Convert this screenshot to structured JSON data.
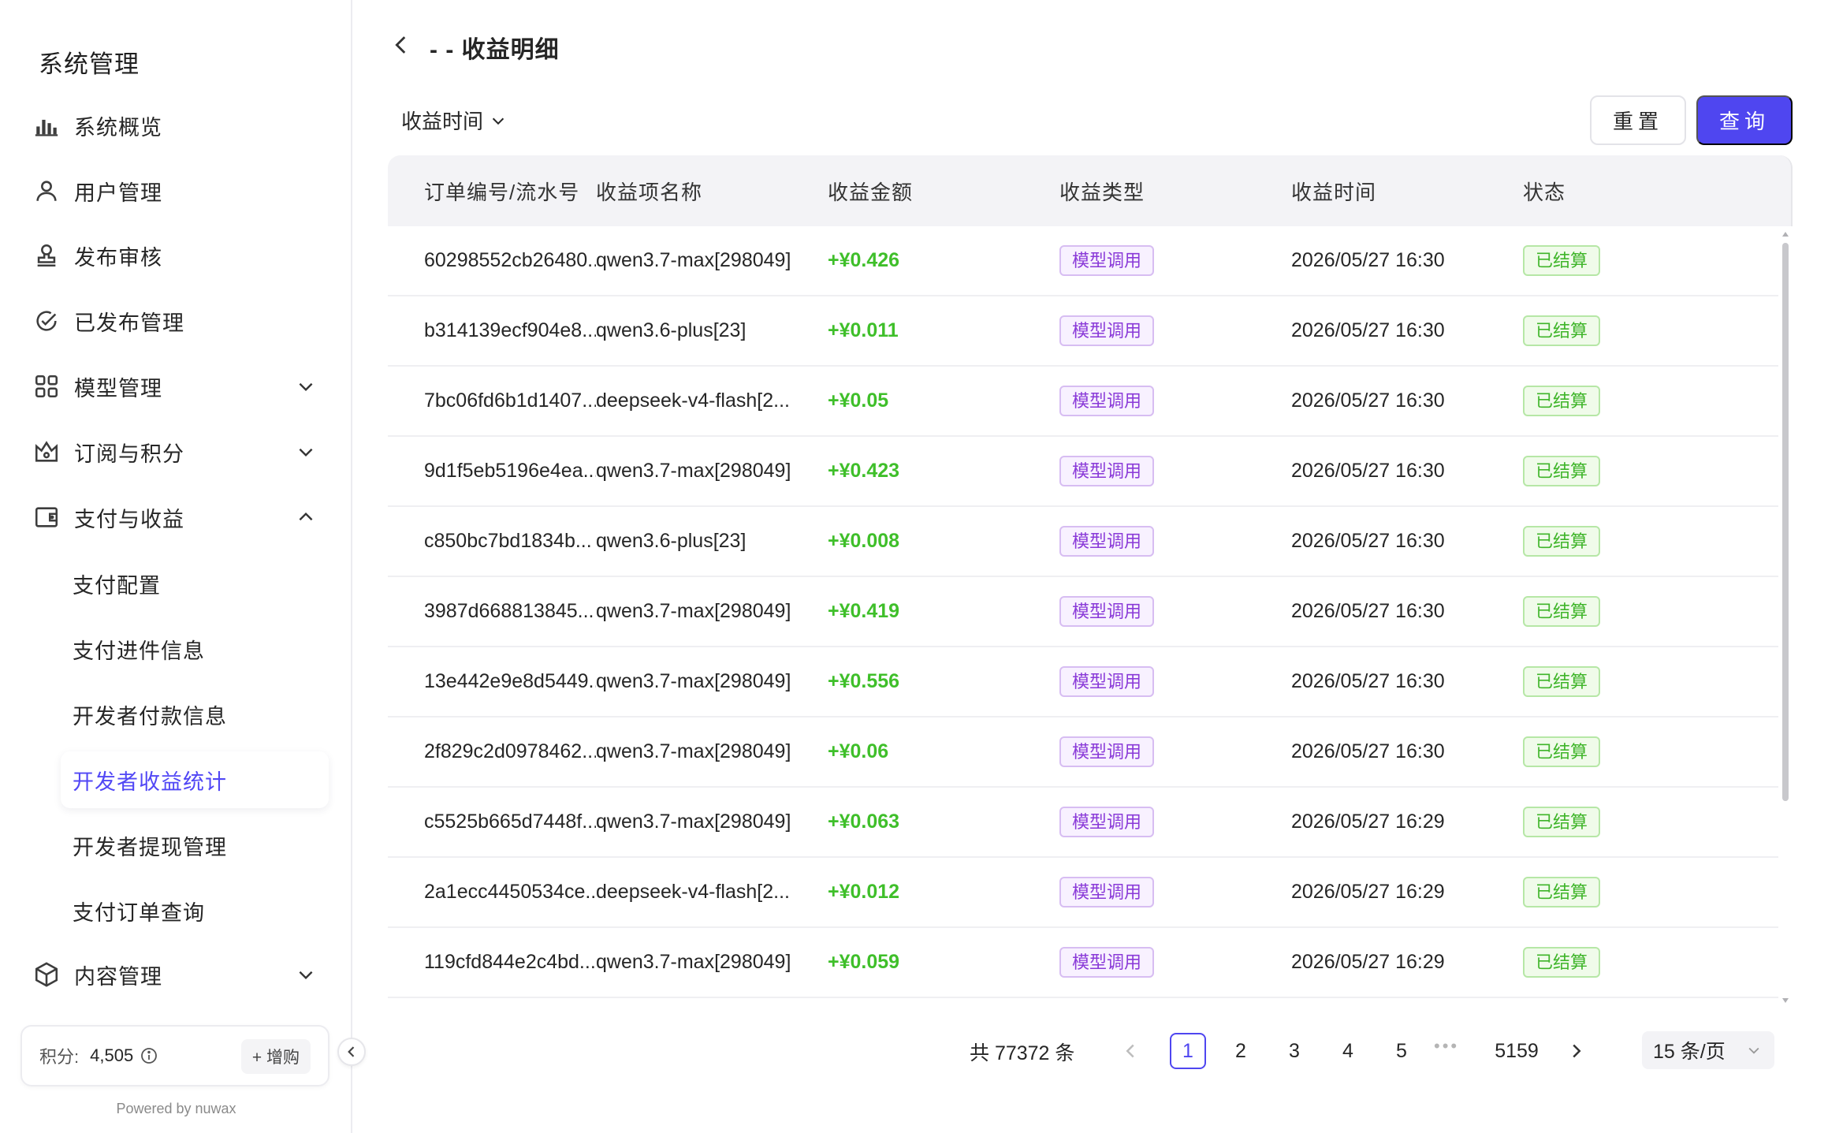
{
  "sidebar": {
    "title": "系统管理",
    "items": [
      {
        "label": "系统概览",
        "icon": "bar-chart-icon"
      },
      {
        "label": "用户管理",
        "icon": "user-icon"
      },
      {
        "label": "发布审核",
        "icon": "stamp-icon"
      },
      {
        "label": "已发布管理",
        "icon": "check-circle-icon"
      },
      {
        "label": "模型管理",
        "icon": "grid-icon",
        "expandable": true,
        "expanded": false
      },
      {
        "label": "订阅与积分",
        "icon": "crown-icon",
        "expandable": true,
        "expanded": false
      },
      {
        "label": "支付与收益",
        "icon": "wallet-icon",
        "expandable": true,
        "expanded": true
      },
      {
        "label": "内容管理",
        "icon": "cube-icon",
        "expandable": true,
        "expanded": false
      }
    ],
    "sub_items": [
      "支付配置",
      "支付进件信息",
      "开发者付款信息",
      "开发者收益统计",
      "开发者提现管理",
      "支付订单查询"
    ],
    "active_sub": "开发者收益统计",
    "points_label": "积分:",
    "points_value": "4,505",
    "buy_label": "+ 增购",
    "powered_by": "Powered by nuwax"
  },
  "header": {
    "title": "- - 收益明细"
  },
  "filter": {
    "label": "收益时间"
  },
  "buttons": {
    "reset": "重置",
    "query": "查询"
  },
  "table": {
    "columns": [
      "订单编号/流水号",
      "收益项名称",
      "收益金额",
      "收益类型",
      "收益时间",
      "状态"
    ],
    "rows": [
      {
        "order": "60298552cb26480...",
        "item": "qwen3.7-max[298049]",
        "amount": "+¥0.426",
        "type": "模型调用",
        "time": "2026/05/27 16:30",
        "status": "已结算"
      },
      {
        "order": "b314139ecf904e8...",
        "item": "qwen3.6-plus[23]",
        "amount": "+¥0.011",
        "type": "模型调用",
        "time": "2026/05/27 16:30",
        "status": "已结算"
      },
      {
        "order": "7bc06fd6b1d1407...",
        "item": "deepseek-v4-flash[2...",
        "amount": "+¥0.05",
        "type": "模型调用",
        "time": "2026/05/27 16:30",
        "status": "已结算"
      },
      {
        "order": "9d1f5eb5196e4ea...",
        "item": "qwen3.7-max[298049]",
        "amount": "+¥0.423",
        "type": "模型调用",
        "time": "2026/05/27 16:30",
        "status": "已结算"
      },
      {
        "order": "c850bc7bd1834b...",
        "item": "qwen3.6-plus[23]",
        "amount": "+¥0.008",
        "type": "模型调用",
        "time": "2026/05/27 16:30",
        "status": "已结算"
      },
      {
        "order": "3987d668813845...",
        "item": "qwen3.7-max[298049]",
        "amount": "+¥0.419",
        "type": "模型调用",
        "time": "2026/05/27 16:30",
        "status": "已结算"
      },
      {
        "order": "13e442e9e8d5449...",
        "item": "qwen3.7-max[298049]",
        "amount": "+¥0.556",
        "type": "模型调用",
        "time": "2026/05/27 16:30",
        "status": "已结算"
      },
      {
        "order": "2f829c2d0978462...",
        "item": "qwen3.7-max[298049]",
        "amount": "+¥0.06",
        "type": "模型调用",
        "time": "2026/05/27 16:30",
        "status": "已结算"
      },
      {
        "order": "c5525b665d7448f...",
        "item": "qwen3.7-max[298049]",
        "amount": "+¥0.063",
        "type": "模型调用",
        "time": "2026/05/27 16:29",
        "status": "已结算"
      },
      {
        "order": "2a1ecc4450534ce...",
        "item": "deepseek-v4-flash[2...",
        "amount": "+¥0.012",
        "type": "模型调用",
        "time": "2026/05/27 16:29",
        "status": "已结算"
      },
      {
        "order": "119cfd844e2c4bd...",
        "item": "qwen3.7-max[298049]",
        "amount": "+¥0.059",
        "type": "模型调用",
        "time": "2026/05/27 16:29",
        "status": "已结算"
      }
    ]
  },
  "pagination": {
    "total": "共 77372 条",
    "pages": [
      "1",
      "2",
      "3",
      "4",
      "5"
    ],
    "current": "1",
    "last": "5159",
    "ellipsis": "•••",
    "page_size": "15 条/页"
  },
  "colors": {
    "accent": "#4f46f0",
    "amount": "#3fbf2a",
    "type_tag": "#8a3ad8",
    "status_tag": "#3fb52a"
  }
}
